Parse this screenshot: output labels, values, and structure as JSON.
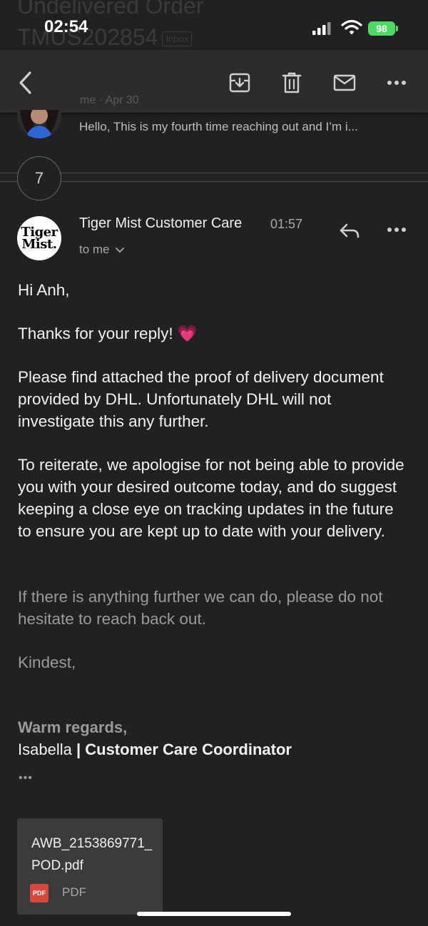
{
  "background_title": {
    "line1": "Undelivered Order",
    "line2": "TMUS202854",
    "tag": "Inbox"
  },
  "status_bar": {
    "time": "02:54",
    "battery": "98"
  },
  "toolbar": {
    "back_icon": "chevron-left-icon",
    "archive_icon": "archive-icon",
    "delete_icon": "trash-icon",
    "mark_unread_icon": "mail-icon",
    "more_icon": "more-horizontal-icon"
  },
  "previous_message": {
    "meta": "me · Apr 30",
    "snippet": "Hello, This is my fourth time reaching out and I’m i..."
  },
  "thread": {
    "collapsed_count": "7"
  },
  "message": {
    "logo_line1": "Tiger",
    "logo_line2": "Mist.",
    "sender": "Tiger Mist Customer Care",
    "time": "01:57",
    "recipient": "to me",
    "greeting": "Hi Anh,",
    "paragraph1": "Thanks for your reply! 💗",
    "paragraph2": "Please find attached the proof of delivery document provided by DHL. Unfortunately DHL will not investigate this any further.",
    "paragraph3": "To reiterate, we apologise for not being able to provide you with your desired outcome today, and do suggest keeping a close eye on tracking updates in the future to ensure you are kept up to date with your delivery.",
    "paragraph4": "If there is anything further we can do, please do not hesitate to reach back out.",
    "closing": "Kindest,",
    "signature_line1": "Warm regards,",
    "signature_name": "Isabella",
    "signature_title": "| Customer Care Coordinator",
    "show_trimmed": "•••"
  },
  "attachment": {
    "filename": "AWB_2153869771_POD.pdf",
    "badge": "PDF",
    "type": "PDF"
  },
  "colors": {
    "background": "#212123",
    "toolbar": "#2c2c2e",
    "battery": "#4cd964",
    "pdf_badge": "#d6493c"
  }
}
